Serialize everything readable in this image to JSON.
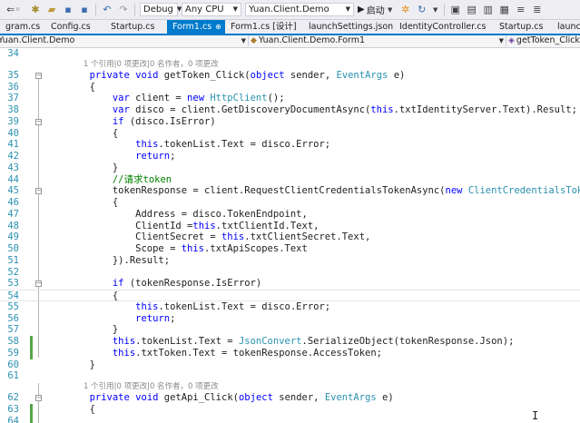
{
  "toolbar": {
    "config": "Debug",
    "platform": "Any CPU",
    "startup_project": "Yuan.Client.Demo",
    "run_label": "启动",
    "icons": [
      "new-project-icon",
      "open-icon",
      "save-icon",
      "save-all-icon",
      "undo-icon",
      "redo-icon",
      "run-icon",
      "refresh-icon",
      "browser-link-icon",
      "toolbox-icon",
      "solution-explorer-icon",
      "bookmark-icon"
    ]
  },
  "tabs": [
    {
      "label": "gram.cs",
      "active": false
    },
    {
      "label": "Config.cs",
      "active": false
    },
    {
      "label": "Startup.cs",
      "active": false
    },
    {
      "label": "Form1.cs",
      "active": true
    },
    {
      "label": "Form1.cs [设计]",
      "active": false
    },
    {
      "label": "launchSettings.json",
      "active": false
    },
    {
      "label": "IdentityController.cs",
      "active": false
    },
    {
      "label": "Startup.cs",
      "active": false
    },
    {
      "label": "launchSetti",
      "active": false
    }
  ],
  "navbar": {
    "project": "Yuan.Client.Demo",
    "class": "Yuan.Client.Demo.Form1",
    "member": "getToken_Click(obje"
  },
  "colors": {
    "accent": "#007acc",
    "keyword": "#0000ff",
    "type": "#2b91af",
    "comment": "#008000",
    "change_marker": "#57a64a"
  },
  "editor": {
    "lens": [
      {
        "before_line": "35",
        "text": "1 个引用|0 项更改|0 名作者，0 项更改"
      },
      {
        "before_line": "62",
        "text": "1 个引用|0 项更改|0 名作者，0 项更改"
      }
    ],
    "lines": [
      {
        "n": "34",
        "tokens": []
      },
      {
        "n": "35",
        "tokens": [
          [
            "        ",
            "m"
          ],
          [
            "private",
            "k"
          ],
          [
            " ",
            "m"
          ],
          [
            "void",
            "k"
          ],
          [
            " getToken_Click(",
            "m"
          ],
          [
            "object",
            "k"
          ],
          [
            " sender, ",
            "m"
          ],
          [
            "EventArgs",
            "t"
          ],
          [
            " e)",
            "m"
          ]
        ]
      },
      {
        "n": "36",
        "tokens": [
          [
            "        {",
            "m"
          ]
        ]
      },
      {
        "n": "37",
        "tokens": [
          [
            "            ",
            "m"
          ],
          [
            "var",
            "k"
          ],
          [
            " client = ",
            "m"
          ],
          [
            "new",
            "k"
          ],
          [
            " ",
            "m"
          ],
          [
            "HttpClient",
            "t"
          ],
          [
            "();",
            "m"
          ]
        ]
      },
      {
        "n": "38",
        "tokens": [
          [
            "            ",
            "m"
          ],
          [
            "var",
            "k"
          ],
          [
            " disco = client.GetDiscoveryDocumentAsync(",
            "m"
          ],
          [
            "this",
            "k"
          ],
          [
            ".txtIdentityServer.Text).Result;",
            "m"
          ]
        ]
      },
      {
        "n": "39",
        "tokens": [
          [
            "            ",
            "m"
          ],
          [
            "if",
            "k"
          ],
          [
            " (disco.IsError)",
            "m"
          ]
        ]
      },
      {
        "n": "40",
        "tokens": [
          [
            "            {",
            "m"
          ]
        ]
      },
      {
        "n": "41",
        "tokens": [
          [
            "                ",
            "m"
          ],
          [
            "this",
            "k"
          ],
          [
            ".tokenList.Text = disco.Error;",
            "m"
          ]
        ]
      },
      {
        "n": "42",
        "tokens": [
          [
            "                ",
            "m"
          ],
          [
            "return",
            "k"
          ],
          [
            ";",
            "m"
          ]
        ]
      },
      {
        "n": "43",
        "tokens": [
          [
            "            }",
            "m"
          ]
        ]
      },
      {
        "n": "44",
        "tokens": [
          [
            "            ",
            "m"
          ],
          [
            "//请求token",
            "c"
          ]
        ]
      },
      {
        "n": "45",
        "tokens": [
          [
            "            tokenResponse = client.RequestClientCredentialsTokenAsync(",
            "m"
          ],
          [
            "new",
            "k"
          ],
          [
            " ",
            "m"
          ],
          [
            "ClientCredentialsTokenRequest",
            "t"
          ]
        ]
      },
      {
        "n": "46",
        "tokens": [
          [
            "            {",
            "m"
          ]
        ]
      },
      {
        "n": "47",
        "tokens": [
          [
            "                Address = disco.TokenEndpoint,",
            "m"
          ]
        ]
      },
      {
        "n": "48",
        "tokens": [
          [
            "                ClientId =",
            "m"
          ],
          [
            "this",
            "k"
          ],
          [
            ".txtClientId.Text,",
            "m"
          ]
        ]
      },
      {
        "n": "49",
        "tokens": [
          [
            "                ClientSecret = ",
            "m"
          ],
          [
            "this",
            "k"
          ],
          [
            ".txtClientSecret.Text,",
            "m"
          ]
        ]
      },
      {
        "n": "50",
        "tokens": [
          [
            "                Scope = ",
            "m"
          ],
          [
            "this",
            "k"
          ],
          [
            ".txtApiScopes.Text",
            "m"
          ]
        ]
      },
      {
        "n": "51",
        "tokens": [
          [
            "            }).Result;",
            "m"
          ]
        ]
      },
      {
        "n": "52",
        "tokens": []
      },
      {
        "n": "53",
        "tokens": [
          [
            "            ",
            "m"
          ],
          [
            "if",
            "k"
          ],
          [
            " (tokenResponse.IsError)",
            "m"
          ]
        ]
      },
      {
        "n": "54",
        "tokens": [
          [
            "            {",
            "m"
          ]
        ]
      },
      {
        "n": "55",
        "tokens": [
          [
            "                ",
            "m"
          ],
          [
            "this",
            "k"
          ],
          [
            ".tokenList.Text = disco.Error;",
            "m"
          ]
        ]
      },
      {
        "n": "56",
        "tokens": [
          [
            "                ",
            "m"
          ],
          [
            "return",
            "k"
          ],
          [
            ";",
            "m"
          ]
        ]
      },
      {
        "n": "57",
        "tokens": [
          [
            "            }",
            "m"
          ]
        ]
      },
      {
        "n": "58",
        "tokens": [
          [
            "            ",
            "m"
          ],
          [
            "this",
            "k"
          ],
          [
            ".tokenList.Text = ",
            "m"
          ],
          [
            "JsonConvert",
            "t"
          ],
          [
            ".SerializeObject(tokenResponse.Json);",
            "m"
          ]
        ]
      },
      {
        "n": "59",
        "tokens": [
          [
            "            ",
            "m"
          ],
          [
            "this",
            "k"
          ],
          [
            ".txtToken.Text = tokenResponse.AccessToken;",
            "m"
          ]
        ]
      },
      {
        "n": "60",
        "tokens": [
          [
            "        }",
            "m"
          ]
        ]
      },
      {
        "n": "61",
        "tokens": []
      },
      {
        "n": "62",
        "tokens": [
          [
            "        ",
            "m"
          ],
          [
            "private",
            "k"
          ],
          [
            " ",
            "m"
          ],
          [
            "void",
            "k"
          ],
          [
            " getApi_Click(",
            "m"
          ],
          [
            "object",
            "k"
          ],
          [
            " sender, ",
            "m"
          ],
          [
            "EventArgs",
            "t"
          ],
          [
            " e)",
            "m"
          ]
        ]
      },
      {
        "n": "63",
        "tokens": [
          [
            "        {",
            "m"
          ]
        ]
      },
      {
        "n": "64",
        "tokens": []
      }
    ]
  }
}
